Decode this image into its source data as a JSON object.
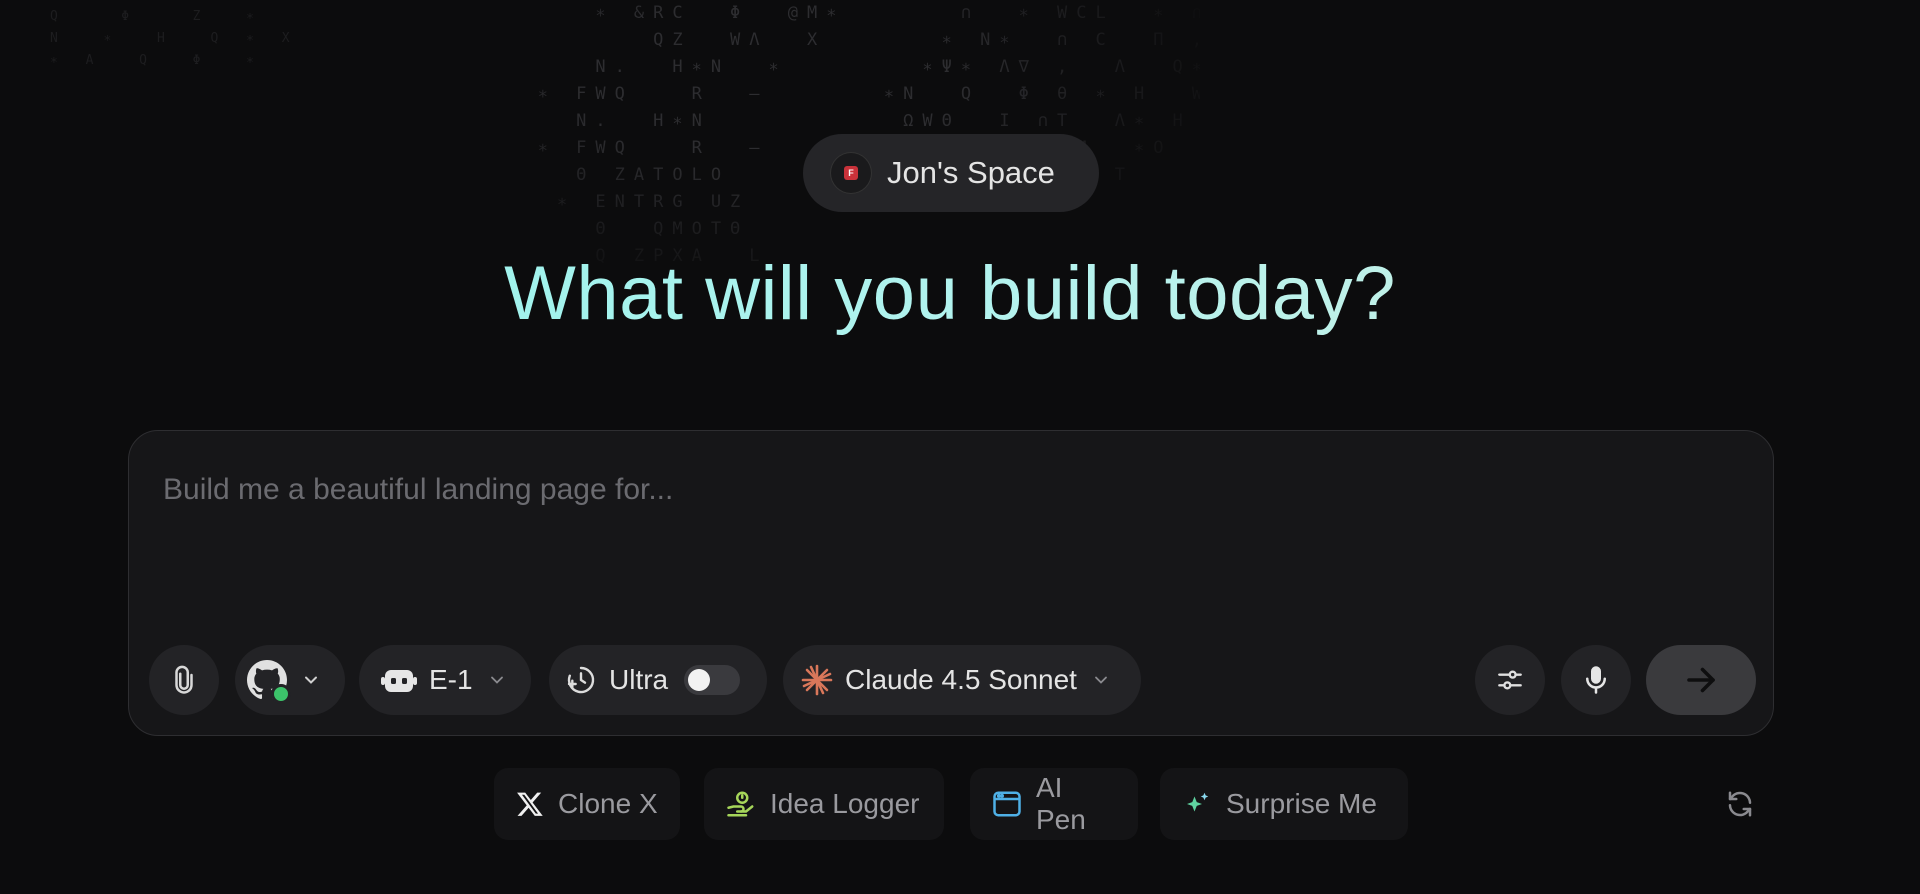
{
  "workspace": {
    "name": "Jon's Space",
    "logo_letter": "F"
  },
  "headline": "What will you build today?",
  "composer": {
    "placeholder": "Build me a beautiful landing page for...",
    "agent": "E-1",
    "mode": "Ultra",
    "mode_enabled": false,
    "model": "Claude 4.5 Sonnet",
    "github_connected": true
  },
  "suggestions": [
    {
      "label": "Clone X",
      "icon": "x-logo-icon"
    },
    {
      "label": "Idea Logger",
      "icon": "idea-hand-icon"
    },
    {
      "label": "AI Pen",
      "icon": "browser-window-icon"
    },
    {
      "label": "Surprise Me",
      "icon": "sparkles-icon"
    }
  ],
  "colors": {
    "background": "#0c0c0d",
    "headline_gradient_start": "#8ff3ec",
    "headline_gradient_end": "#cfeee0",
    "composer_bg": "#161618",
    "github_status": "#3cc36a",
    "claude_accent": "#d9775a"
  }
}
